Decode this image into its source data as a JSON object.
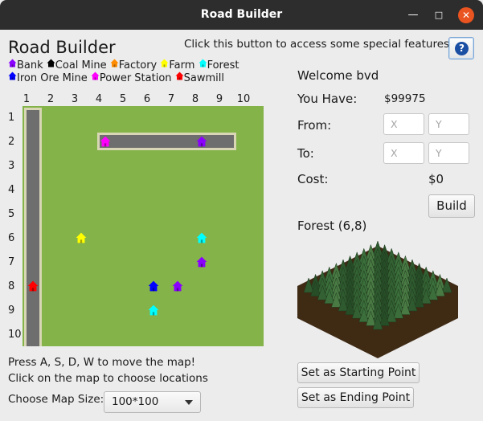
{
  "window": {
    "title": "Road Builder"
  },
  "header": {
    "app_title": "Road Builder",
    "hint": "Click this button to access some special features!",
    "help_icon": "question-icon",
    "help_glyph": "?"
  },
  "legend": {
    "bank": {
      "label": "Bank",
      "color": "#8a00ff"
    },
    "coal_mine": {
      "label": "Coal Mine",
      "color": "#000000"
    },
    "factory": {
      "label": "Factory",
      "color": "#ff8c00"
    },
    "farm": {
      "label": "Farm",
      "color": "#ffff00"
    },
    "forest": {
      "label": "Forest",
      "color": "#00ffff"
    },
    "iron_ore_mine": {
      "label": "Iron Ore Mine",
      "color": "#0000ff"
    },
    "power_station": {
      "label": "Power Station",
      "color": "#ff00ff"
    },
    "sawmill": {
      "label": "Sawmill",
      "color": "#ff0000"
    }
  },
  "map": {
    "columns": [
      "1",
      "2",
      "3",
      "4",
      "5",
      "6",
      "7",
      "8",
      "9",
      "10"
    ],
    "rows": [
      "1",
      "2",
      "3",
      "4",
      "5",
      "6",
      "7",
      "8",
      "9",
      "10"
    ],
    "terrain_color": "#84b34a",
    "road_color": "#6e6e6e",
    "roads": [
      {
        "from": [
          1,
          1
        ],
        "to": [
          1,
          10
        ]
      },
      {
        "from": [
          4,
          2
        ],
        "to": [
          8,
          2
        ]
      }
    ],
    "buildings": [
      {
        "type": "power_station",
        "col": 4,
        "row": 2
      },
      {
        "type": "bank",
        "col": 8,
        "row": 2
      },
      {
        "type": "farm",
        "col": 3,
        "row": 6
      },
      {
        "type": "forest",
        "col": 8,
        "row": 6
      },
      {
        "type": "bank",
        "col": 8,
        "row": 7
      },
      {
        "type": "sawmill",
        "col": 1,
        "row": 8
      },
      {
        "type": "iron_ore_mine",
        "col": 6,
        "row": 8
      },
      {
        "type": "bank",
        "col": 7,
        "row": 8
      },
      {
        "type": "forest",
        "col": 6,
        "row": 9
      }
    ]
  },
  "footer": {
    "instructions_move": "Press A, S, D, W to move the map!",
    "instructions_click": "Click on the map to choose locations",
    "map_size_label": "Choose Map Size:",
    "map_size_value": "100*100"
  },
  "panel": {
    "welcome": "Welcome bvd",
    "you_have_label": "You Have:",
    "money": "$99975",
    "from_label": "From:",
    "to_label": "To:",
    "x_placeholder": "X",
    "y_placeholder": "Y",
    "cost_label": "Cost:",
    "cost_value": "$0",
    "build_button": "Build",
    "selected_tile": "Forest (6,8)",
    "set_start_button": "Set as Starting Point",
    "set_end_button": "Set as Ending Point"
  }
}
